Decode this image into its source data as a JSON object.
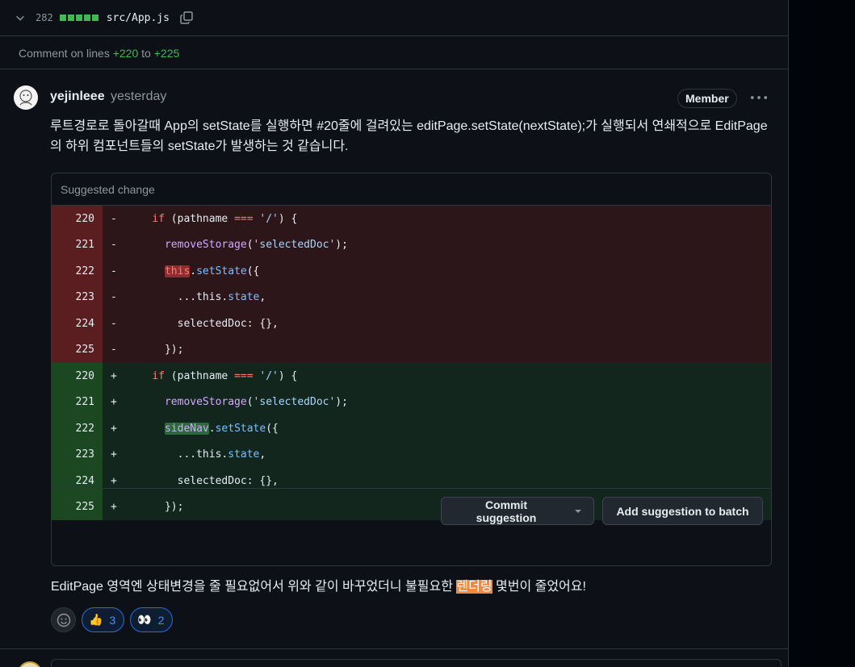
{
  "file": {
    "diff_count": "282",
    "filename": "src/App.js"
  },
  "lines_note": {
    "prefix": "Comment on lines",
    "from": "+220",
    "to_word": "to",
    "to": "+225"
  },
  "comment": {
    "author": "yejinleee",
    "time": "yesterday",
    "badge": "Member",
    "body": "루트경로로 돌아갈때 App의 setState를 실행하면 #20줄에 걸려있는 editPage.setState(nextState);가 실행되서 연쇄적으로 EditPage의 하위 컴포넌트들의 setState가 발생하는 것 같습니다.",
    "suggestion_title": "Suggested change",
    "deleted": [
      {
        "num": "220",
        "sign": "-"
      },
      {
        "num": "221",
        "sign": "-"
      },
      {
        "num": "222",
        "sign": "-"
      },
      {
        "num": "223",
        "sign": "-"
      },
      {
        "num": "224",
        "sign": "-"
      },
      {
        "num": "225",
        "sign": "-"
      }
    ],
    "added": [
      {
        "num": "220",
        "sign": "+"
      },
      {
        "num": "221",
        "sign": "+"
      },
      {
        "num": "222",
        "sign": "+"
      },
      {
        "num": "223",
        "sign": "+"
      },
      {
        "num": "224",
        "sign": "+"
      },
      {
        "num": "225",
        "sign": "+"
      }
    ],
    "code": {
      "if_kw": "if",
      "if_open": " (pathname ",
      "if_op": "===",
      "if_str": "'/'",
      "if_close": ") {",
      "remove_fn": "removeStorage",
      "remove_str": "'selectedDoc'",
      "paren_open": "(",
      "paren_close": ");",
      "this_kw": "this",
      "sidenav": "sideNav",
      "dot": ".",
      "setstate": "setState",
      "setstate_open": "({",
      "spread": "...this.",
      "state": "state",
      "comma": ",",
      "selected": "selectedDoc: {},",
      "close": "});"
    },
    "commit_button": "Commit suggestion",
    "batch_button": "Add suggestion to batch",
    "footer_before": "EditPage 영역엔 상태변경을 줄 필요없어서 위와 같이 바꾸었더니 불필요한 ",
    "footer_mark": "렌더링",
    "footer_after": " 몇번이 줄었어요!",
    "reactions": [
      {
        "emoji": "👍",
        "count": "3"
      },
      {
        "emoji": "👀",
        "count": "2"
      }
    ]
  },
  "colors": {
    "bg": "#0d1117",
    "added_gutter": "#1b4721",
    "deleted_gutter": "#5a1e21",
    "accent": "#3fb950",
    "highlight": "#f0883e"
  }
}
